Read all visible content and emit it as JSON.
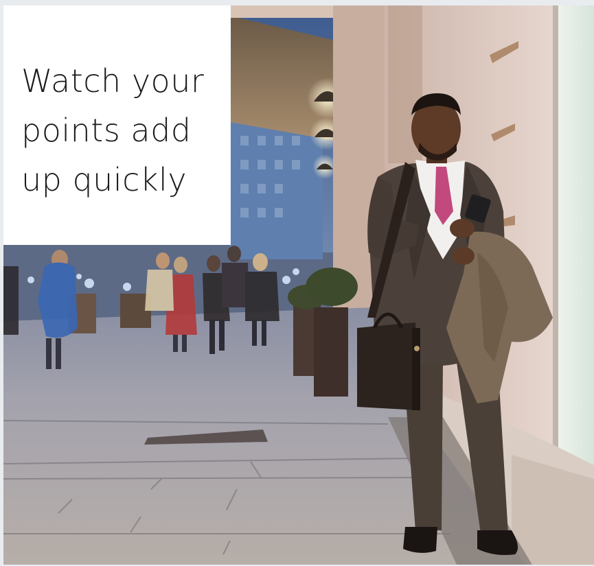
{
  "banner": {
    "headline_lines": [
      "Watch your",
      "points add",
      "up quickly"
    ],
    "photo_alt": "Smiling man in a suit with a leather bag and coat over his arm, looking at a shop window on a city street at dusk"
  }
}
